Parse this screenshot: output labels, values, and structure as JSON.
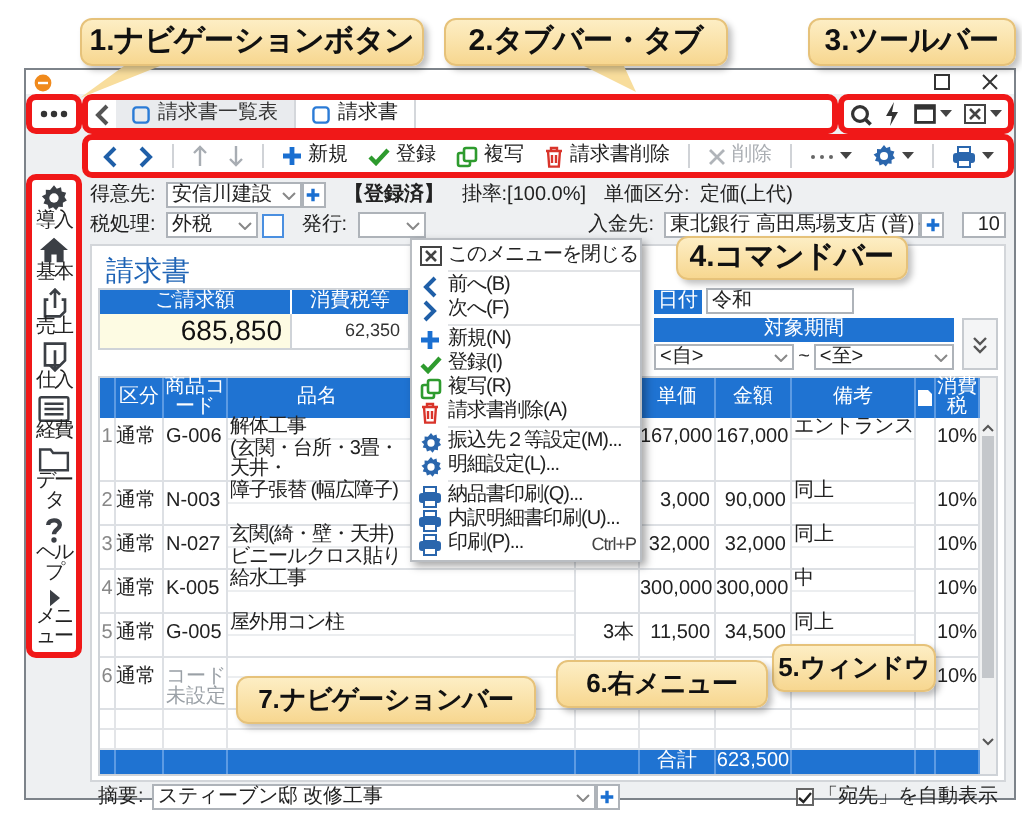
{
  "callouts": [
    {
      "text": "1.ナビゲーションボタン"
    },
    {
      "text": "2.タブバー・タブ"
    },
    {
      "text": "3.ツールバー"
    },
    {
      "text": "4.コマンドバー"
    },
    {
      "text": "5.ウィンドウ"
    },
    {
      "text": "6.右メニュー"
    },
    {
      "text": "7.ナビゲーションバー"
    }
  ],
  "tabs": [
    {
      "label": "請求書一覧表",
      "selected": false
    },
    {
      "label": "請求書",
      "selected": true
    }
  ],
  "command_bar": [
    {
      "label": "新規",
      "disabled": false
    },
    {
      "label": "登録",
      "disabled": false
    },
    {
      "label": "複写",
      "disabled": false
    },
    {
      "label": "請求書削除",
      "disabled": false
    },
    {
      "label": "削除",
      "disabled": true
    }
  ],
  "nav_bar": [
    {
      "label": "導入"
    },
    {
      "label": "基本"
    },
    {
      "label": "売上"
    },
    {
      "label": "仕入"
    },
    {
      "label": "経費"
    },
    {
      "label": "データ"
    },
    {
      "label": "ヘルプ"
    },
    {
      "label": "メニュー"
    }
  ],
  "form": {
    "customer_label": "得意先:",
    "customer": "安信川建設",
    "status": "【登録済】",
    "rate": "掛率:[100.0%]",
    "price_class_label": "単価区分:",
    "price_class": "定価(上代)",
    "tax_label": "税処理:",
    "tax": "外税",
    "issue_label": "発行:",
    "payee_label": "入金先:",
    "payee": "東北銀行 高田馬場支店 (普)",
    "right_field": "10"
  },
  "document": {
    "title": "請求書",
    "billed_label": "ご請求額",
    "billed": "685,850",
    "tax_label": "消費税等",
    "tax": "62,350",
    "date_label": "日付",
    "date": "令和",
    "period_label": "対象期間",
    "period_from": "<自>",
    "period_sep": "~",
    "period_to": "<至>"
  },
  "table": {
    "columns": [
      {
        "label": "区分"
      },
      {
        "label": "商品コード"
      },
      {
        "label": "品名"
      },
      {
        "label": "単価"
      },
      {
        "label": "金額"
      },
      {
        "label": "備考"
      },
      {
        "label": "消費税"
      }
    ],
    "rows": [
      {
        "no": "1",
        "type": "通常",
        "code": "G-006",
        "code_set": true,
        "name": [
          "解体工事",
          "(玄関・台所・3畳・天井・"
        ],
        "price": "167,000",
        "amount": "167,000",
        "remarks": "エントランス",
        "tax": "10%"
      },
      {
        "no": "2",
        "type": "通常",
        "code": "N-003",
        "code_set": true,
        "name": [
          "障子張替 (幅広障子)"
        ],
        "price": "3,000",
        "amount": "90,000",
        "remarks": "同上",
        "tax": "10%"
      },
      {
        "no": "3",
        "type": "通常",
        "code": "N-027",
        "code_set": true,
        "name": [
          "玄関(綺・壁・天井)",
          "ビニールクロス貼り"
        ],
        "price": "32,000",
        "amount": "32,000",
        "remarks": "同上",
        "tax": "10%"
      },
      {
        "no": "4",
        "type": "通常",
        "code": "K-005",
        "code_set": true,
        "name": [
          "給水工事"
        ],
        "price": "300,000",
        "amount": "300,000",
        "remarks": "中",
        "tax": "10%"
      },
      {
        "no": "5",
        "type": "通常",
        "code": "G-005",
        "code_set": true,
        "name": [
          "屋外用コン柱"
        ],
        "qty": "3本",
        "price": "11,500",
        "amount": "34,500",
        "remarks": "同上",
        "tax": "10%"
      },
      {
        "no": "6",
        "type": "通常",
        "code": "コード未設定",
        "code_set": false,
        "name": [],
        "tax": "10%"
      }
    ],
    "total_label": "合計",
    "total": "623,500"
  },
  "footer": {
    "memo_label": "摘要:",
    "memo": "スティーブン邸 改修工事",
    "auto_address": {
      "label": "「宛先」を自動表示",
      "checked": true
    }
  },
  "context_menu": [
    [
      {
        "label": "このメニューを閉じる"
      }
    ],
    [
      {
        "label": "前へ(B)"
      },
      {
        "label": "次へ(F)"
      }
    ],
    [
      {
        "label": "新規(N)"
      },
      {
        "label": "登録(I)"
      },
      {
        "label": "複写(R)"
      },
      {
        "label": "請求書削除(A)"
      }
    ],
    [
      {
        "label": "振込先２等設定(M)..."
      },
      {
        "label": "明細設定(L)..."
      }
    ],
    [
      {
        "label": "納品書印刷(Q)..."
      },
      {
        "label": "内訳明細書印刷(U)..."
      },
      {
        "label": "印刷(P)...",
        "shortcut": "Ctrl+P"
      }
    ]
  ]
}
